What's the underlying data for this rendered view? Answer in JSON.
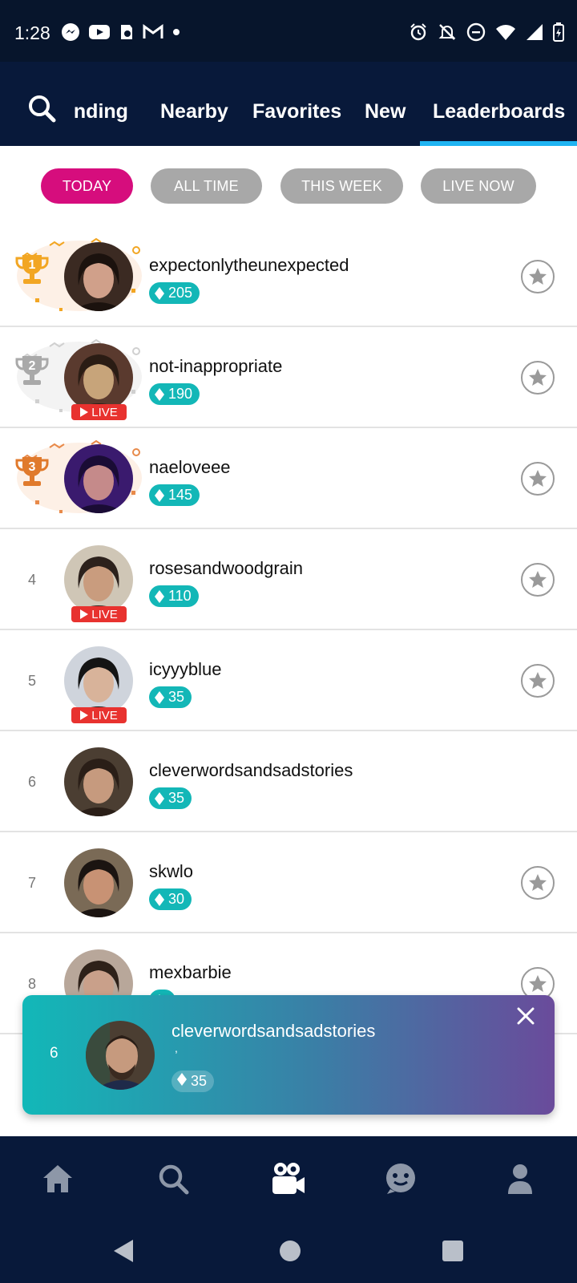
{
  "status_bar": {
    "time": "1:28",
    "left_icons": [
      "messenger-icon",
      "youtube-icon",
      "app-icon",
      "gmail-icon",
      "dot-icon"
    ],
    "right_icons": [
      "alarm-icon",
      "notifications-off-icon",
      "do-not-disturb-icon",
      "wifi-icon",
      "signal-icon",
      "battery-charging-icon"
    ]
  },
  "header": {
    "tabs": [
      {
        "label": "ending",
        "active": false
      },
      {
        "label": "Nearby",
        "active": false
      },
      {
        "label": "Favorites",
        "active": false
      },
      {
        "label": "New",
        "active": false
      },
      {
        "label": "Leaderboards",
        "active": true
      }
    ],
    "accent_color": "#1fb4f2"
  },
  "filters": [
    {
      "label": "TODAY",
      "active": true
    },
    {
      "label": "ALL TIME",
      "active": false
    },
    {
      "label": "THIS WEEK",
      "active": false
    },
    {
      "label": "LIVE NOW",
      "active": false
    }
  ],
  "leaderboard": [
    {
      "rank": "1",
      "name": "expectonlytheunexpected",
      "score": "205",
      "live": false,
      "trophy": "gold",
      "favorite_button": true
    },
    {
      "rank": "2",
      "name": "not-inappropriate",
      "score": "190",
      "live": true,
      "trophy": "silver",
      "favorite_button": true
    },
    {
      "rank": "3",
      "name": "naeloveee",
      "score": "145",
      "live": false,
      "trophy": "bronze",
      "favorite_button": true
    },
    {
      "rank": "4",
      "name": "rosesandwoodgrain",
      "score": "110",
      "live": true,
      "favorite_button": true
    },
    {
      "rank": "5",
      "name": "icyyyblue",
      "score": "35",
      "live": true,
      "favorite_button": true
    },
    {
      "rank": "6",
      "name": "cleverwordsandsadstories",
      "score": "35",
      "live": false,
      "favorite_button": false
    },
    {
      "rank": "7",
      "name": "skwlo",
      "score": "30",
      "live": false,
      "favorite_button": true
    },
    {
      "rank": "8",
      "name": "mexbarbie",
      "score": "",
      "live": true,
      "favorite_button": true
    }
  ],
  "live_label": "LIVE",
  "my_rank_card": {
    "rank": "6",
    "name": "cleverwordsandsadstories",
    "subtitle": ",",
    "score": "35"
  },
  "bottom_nav": [
    "home-icon",
    "search-icon",
    "live-video-icon",
    "chat-icon",
    "profile-icon"
  ],
  "colors": {
    "pill_active": "#d60d7d",
    "pill_inactive": "#a8a8a8",
    "gem_badge": "#13b7b7",
    "live_badge": "#e8322f",
    "nav_bg": "#08193a"
  }
}
